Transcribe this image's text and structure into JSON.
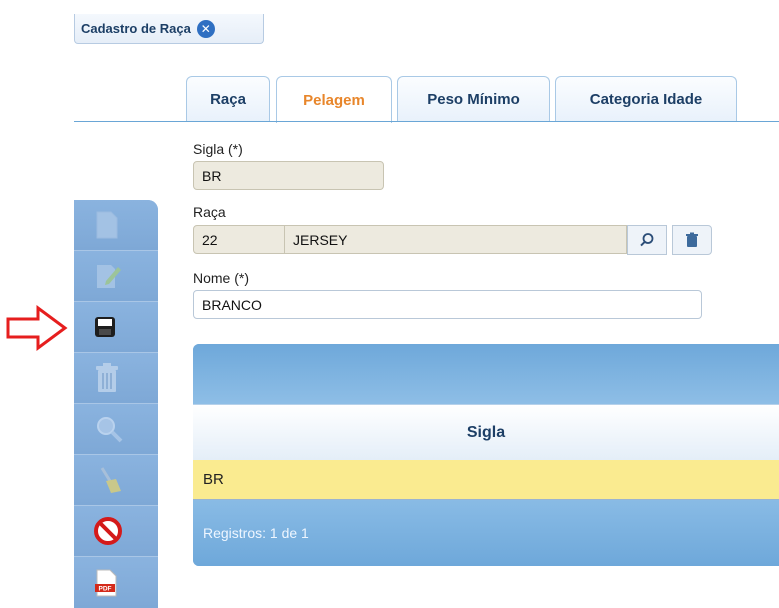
{
  "window_tab": {
    "title": "Cadastro de Raça",
    "close_icon": "close-circle-icon"
  },
  "tabs": [
    {
      "label": "Raça"
    },
    {
      "label": "Pelagem"
    },
    {
      "label": "Peso Mínimo"
    },
    {
      "label": "Categoria Idade"
    }
  ],
  "active_tab": "Pelagem",
  "form": {
    "sigla_label": "Sigla (*)",
    "sigla_value": "BR",
    "raca_label": "Raça",
    "raca_code": "22",
    "raca_name": "JERSEY",
    "nome_label": "Nome (*)",
    "nome_value": "BRANCO"
  },
  "toolbar": {
    "buttons": [
      "new-icon",
      "edit-icon",
      "save-icon",
      "delete-icon",
      "search-icon",
      "clear-icon",
      "cancel-icon",
      "pdf-icon"
    ]
  },
  "grid": {
    "column_header": "Sigla",
    "rows": [
      {
        "sigla": "BR"
      }
    ],
    "footer": "Registros: 1 de 1"
  },
  "colors": {
    "accent": "#e8862b",
    "brand": "#1d3f66",
    "toolbar": "#8fb5de",
    "selected_row": "#faeb90"
  }
}
